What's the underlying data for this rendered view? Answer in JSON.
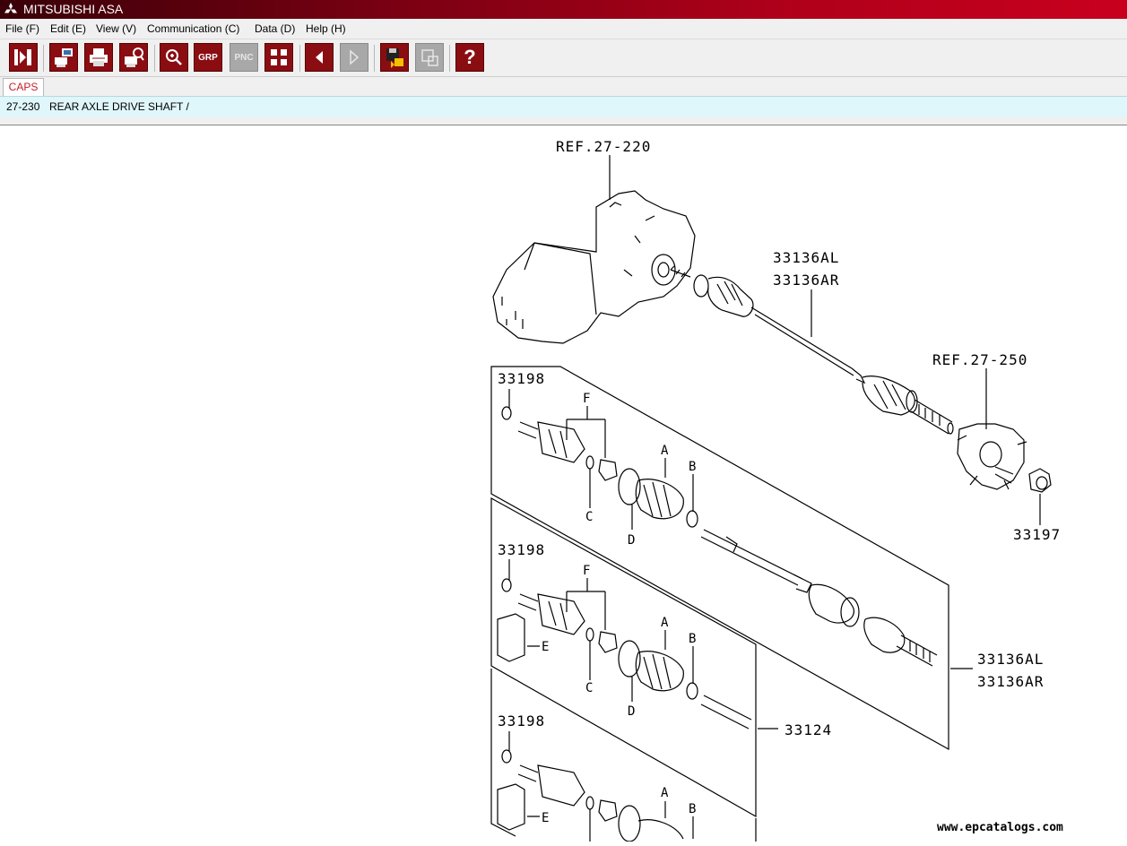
{
  "app": {
    "title": "MITSUBISHI ASA"
  },
  "menu": [
    "File (F)",
    "Edit (E)",
    "View (V)",
    "Communication (C)",
    "Data (D)",
    "Help (H)"
  ],
  "toolbar": {
    "grp_label": "GRP",
    "pnc_label": "PNC",
    "help_label": "?"
  },
  "tab": {
    "label": "CAPS"
  },
  "path": {
    "code": "27-230",
    "title": "REAR AXLE DRIVE SHAFT /"
  },
  "diagram": {
    "ref_top": "REF.27-220",
    "part_main_l": "33136AL",
    "part_main_r": "33136AR",
    "ref_hub": "REF.27-250",
    "nut": "33197",
    "ring1": "33198",
    "ring2": "33198",
    "ring3": "33198",
    "kit_l": "33136AL",
    "kit_r": "33136AR",
    "shaft": "33124",
    "letters": {
      "A": "A",
      "B": "B",
      "C": "C",
      "D": "D",
      "E": "E",
      "F": "F"
    },
    "watermark": "www.epcatalogs.com"
  }
}
